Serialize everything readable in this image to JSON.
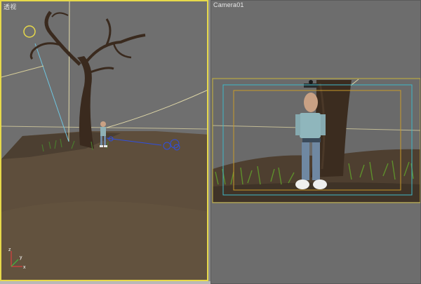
{
  "viewports": {
    "left": {
      "label": "透视",
      "active": true
    },
    "right": {
      "label": "Camera01",
      "active": false
    }
  },
  "colors": {
    "active_border": "#e7d94a",
    "viewport_bg": "#6f6f6f",
    "safe_frame_outer": "#c8b43a",
    "safe_frame_action": "#3fb8c8",
    "safe_frame_title": "#c89a2a",
    "ground": "#5a4a3a",
    "grass": "#3e6a2a"
  },
  "icons": {
    "axis_gizmo": "xyz-axis-icon",
    "camera_target": "camera-target-icon",
    "light": "light-icon"
  }
}
